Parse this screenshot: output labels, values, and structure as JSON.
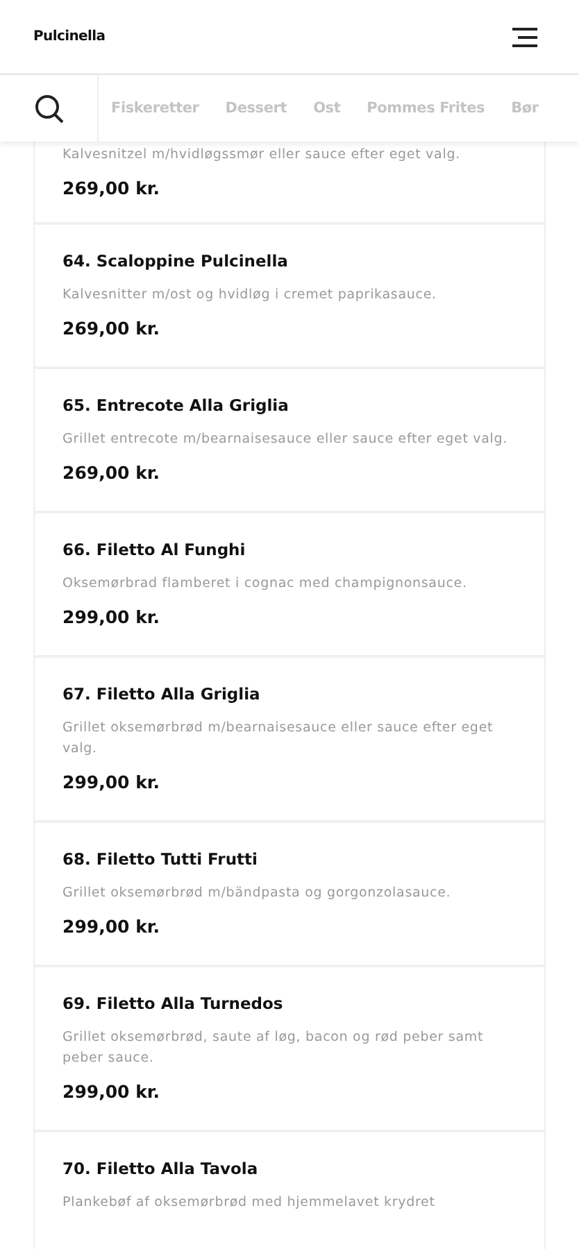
{
  "header": {
    "title": "Pulcinella"
  },
  "tabs": [
    {
      "label": "Fiskeretter",
      "selected": false
    },
    {
      "label": "Dessert",
      "selected": false
    },
    {
      "label": "Ost",
      "selected": false
    },
    {
      "label": "Pommes Frites",
      "selected": false
    },
    {
      "label": "Bør",
      "selected": false
    }
  ],
  "items": [
    {
      "description": "Kalvesnitzel m/hvidløgssmør eller sauce efter eget valg.",
      "price": "269,00 kr."
    },
    {
      "name": "64. Scaloppine Pulcinella",
      "description": "Kalvesnitter m/ost og hvidløg i cremet paprikasauce.",
      "price": "269,00 kr."
    },
    {
      "name": "65. Entrecote Alla Griglia",
      "description": "Grillet entrecote m/bearnaisesauce eller sauce efter eget valg.",
      "price": "269,00 kr."
    },
    {
      "name": "66. Filetto Al Funghi",
      "description": "Oksemørbrad flamberet i cognac med champignonsauce.",
      "price": "299,00 kr."
    },
    {
      "name": "67. Filetto Alla Griglia",
      "description": "Grillet oksemørbrød m/bearnaisesauce eller sauce efter eget valg.",
      "price": "299,00 kr."
    },
    {
      "name": "68. Filetto Tutti Frutti",
      "description": "Grillet oksemørbrød m/bändpasta og gorgonzolasauce.",
      "price": "299,00 kr."
    },
    {
      "name": "69. Filetto Alla Turnedos",
      "description": "Grillet oksemørbrød, saute af løg, bacon og rød peber samt peber sauce.",
      "price": "299,00 kr."
    },
    {
      "name": "70. Filetto Alla Tavola",
      "description": "Plankebøf af oksemørbrød med hjemmelavet krydret"
    }
  ]
}
